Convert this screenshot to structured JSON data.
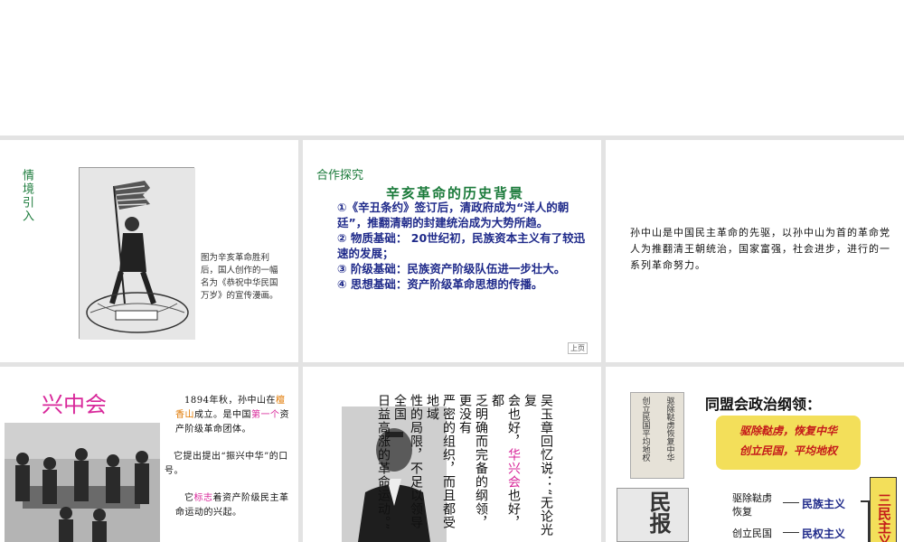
{
  "slides": {
    "s1": {
      "side_title": "情境引入",
      "caption": "图为辛亥革命胜利后，国人创作的一幅名为《恭祝中华民国万岁》的宣传漫画。"
    },
    "s2": {
      "section": "合作探究",
      "title": "辛亥革命的历史背景",
      "items": [
        "①《辛丑条约》签订后，清政府成为“洋人的朝廷”，推翻清朝的封建统治成为大势所趋。",
        "② 物质基础： 20世纪初，民族资本主义有了较迅速的发展；",
        "③ 阶级基础：民族资产阶级队伍进一步壮大。",
        "④ 思想基础：资产阶级革命思想的传播。"
      ],
      "nav_label": "上页"
    },
    "s3": {
      "text": "孙中山是中国民主革命的先驱，以孙中山为首的革命党人为推翻清王朝统治，国家富强，社会进步，进行的一系列革命努力。"
    },
    "s4": {
      "title": "兴中会",
      "p1_a": "1894年秋，孙中山在",
      "p1_b": "檀香山",
      "p1_c": "成立。是中国",
      "p1_d": "第一个",
      "p1_e": "资产阶级革命团体。",
      "p2": "它提出提出“振兴中华”的口号。",
      "p3_a": "它",
      "p3_b": "标志",
      "p3_c": "着资产阶级民主革命运动的兴起。"
    },
    "s5": {
      "v1": "吴玉章回忆说：“无论光复",
      "v2_a": "会也好，",
      "v2_b": "华兴会",
      "v2_c": "也好，都",
      "v3": "乏明确而完备的纲领，更没有",
      "v4": "严密的组织，而且都受地域",
      "v5": "性的局限，不足以领导全国",
      "v6": "日益高涨的革命运动。”"
    },
    "s6": {
      "title": "同盟会政治纲领：",
      "banner1": "驱除鞑虏，恢复中华",
      "banner2": "创立民国，平均地权",
      "calligraphy1": "驱除鞑虏恢复中华",
      "calligraphy2": "创立民国平均地权",
      "newspaper": "民报",
      "row1_left": "驱除鞑虏恢复",
      "row1_right": "民族主义",
      "row2_left": "创立民国",
      "row2_right": "民权主义",
      "side_box": "三民主义"
    }
  },
  "colors": {
    "green_title": "#1a7a3a",
    "navy": "#1f2a8a",
    "pink": "#d8279a",
    "orange": "#e07800",
    "red_banner": "#c41a1a",
    "yellow_banner": "#f3df5a"
  }
}
